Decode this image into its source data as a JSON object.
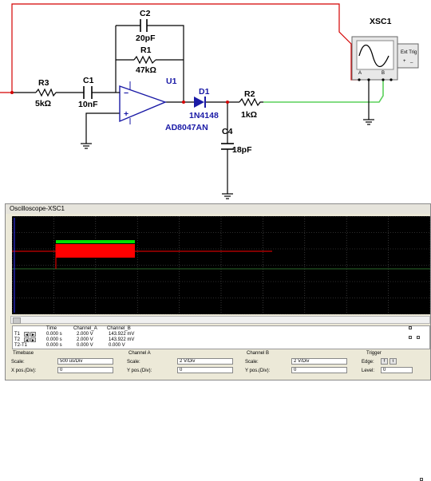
{
  "schematic": {
    "components": {
      "r3": {
        "ref": "R3",
        "value": "5kΩ"
      },
      "c1": {
        "ref": "C1",
        "value": "10nF"
      },
      "c2": {
        "ref": "C2",
        "value": "20pF"
      },
      "r1": {
        "ref": "R1",
        "value": "47kΩ"
      },
      "u1": {
        "ref": "U1",
        "value": "AD8047AN"
      },
      "d1": {
        "ref": "D1",
        "value": "1N4148"
      },
      "r2": {
        "ref": "R2",
        "value": "1kΩ"
      },
      "c4": {
        "ref": "C4",
        "value": "18pF"
      }
    },
    "opamp": {
      "minus": "−",
      "plus": "+"
    },
    "instrument": {
      "name": "XSC1",
      "ext_trig": "Ext Trig",
      "port_a": "A",
      "port_b": "B",
      "port_plus": "+",
      "port_minus": "_"
    },
    "colors": {
      "channel_a_wire": "#d40000",
      "channel_b_wire": "#5ad05a",
      "wire": "#000000",
      "label_blue": "#1a1aa6"
    }
  },
  "oscilloscope": {
    "title": "Oscilloscope-XSC1",
    "screen": {
      "background": "#000000",
      "grid": "#5a5a5a",
      "trace_a": "#ff0000",
      "trace_b": "#00e000",
      "trace_dark_green": "#2c6c2c"
    },
    "readout": {
      "headers": {
        "time": "Time",
        "channel_a": "Channel_A",
        "channel_b": "Channel_B"
      },
      "rows": [
        {
          "label": "T1",
          "time": "0.000 s",
          "a": "2.000 V",
          "b": "143.922 mV"
        },
        {
          "label": "T2",
          "time": "0.000 s",
          "a": "2.000 V",
          "b": "143.922 mV"
        },
        {
          "label": "T2-T1",
          "time": "0.000 s",
          "a": "0.000 V",
          "b": "0.000 V"
        }
      ],
      "arrow_left": "◄",
      "arrow_right": "►"
    },
    "timebase": {
      "title": "Timebase",
      "scale_label": "Scale:",
      "scale_value": "500 us/Div",
      "xpos_label": "X pos.(Div):",
      "xpos_value": "0"
    },
    "channel_a": {
      "title": "Channel A",
      "scale_label": "Scale:",
      "scale_value": "2  V/Div",
      "ypos_label": "Y pos.(Div):",
      "ypos_value": "0"
    },
    "channel_b": {
      "title": "Channel B",
      "scale_label": "Scale:",
      "scale_value": "2  V/Div",
      "ypos_label": "Y pos.(Div):",
      "ypos_value": "0"
    },
    "trigger": {
      "title": "Trigger",
      "edge_label": "Edge:",
      "level_label": "Level:",
      "level_value": "0",
      "edge_rising": "f",
      "edge_falling": "t"
    }
  }
}
